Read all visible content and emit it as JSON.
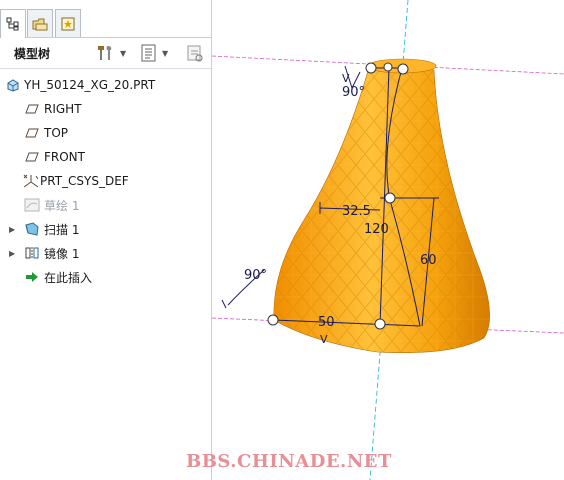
{
  "panel": {
    "tabs": [
      {
        "icon": "model-tree-icon"
      },
      {
        "icon": "folder-browser-icon"
      },
      {
        "icon": "favorites-icon"
      }
    ],
    "title": "模型树",
    "toolbar": {
      "settings_icon": "settings-icon",
      "show_icon": "show-list-icon",
      "filter_icon": "filter-icon"
    }
  },
  "tree": {
    "items": [
      {
        "label": "YH_50124_XG_20.PRT",
        "icon": "part-icon"
      },
      {
        "label": "RIGHT",
        "icon": "datum-plane-icon"
      },
      {
        "label": "TOP",
        "icon": "datum-plane-icon"
      },
      {
        "label": "FRONT",
        "icon": "datum-plane-icon"
      },
      {
        "label": "PRT_CSYS_DEF",
        "icon": "csys-icon"
      },
      {
        "label": "草绘 1",
        "icon": "sketch-icon",
        "state": "suppressed"
      },
      {
        "label": "扫描 1",
        "icon": "sweep-icon"
      },
      {
        "label": "镜像 1",
        "icon": "mirror-icon"
      },
      {
        "label": "在此插入",
        "icon": "insert-here-arrow-icon"
      }
    ]
  },
  "viewport": {
    "model_color": "#f5a20d",
    "dimensions": {
      "top_angle": "90°",
      "width_top": "32.5",
      "height_mid": "120",
      "height_right": "60",
      "bottom_angle": "90°",
      "bottom_width": "50"
    },
    "sketch_markers": {
      "vertical_top": "V",
      "vertical_bottom": "V"
    }
  },
  "watermark": "BBS.CHINADE.NET"
}
